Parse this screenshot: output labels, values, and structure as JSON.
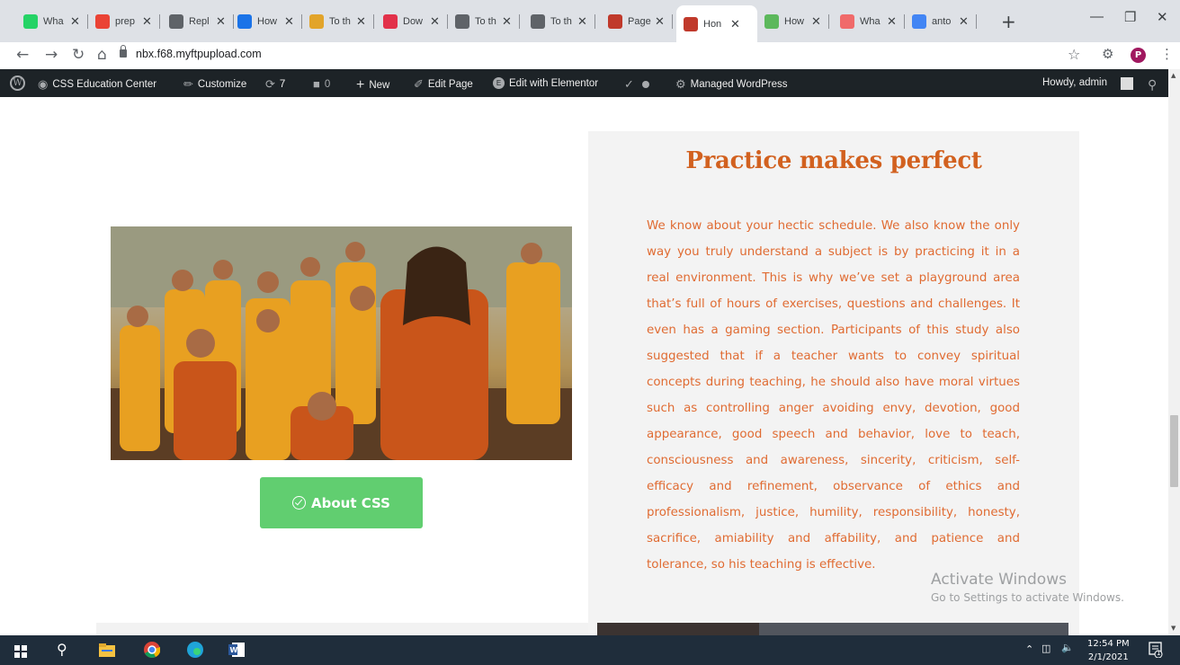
{
  "browser": {
    "tabs": [
      {
        "title": "Wha",
        "icon": "whatsapp-icon",
        "color": "#25d366"
      },
      {
        "title": "prep",
        "icon": "gmail-icon",
        "color": "#ea4335"
      },
      {
        "title": "Repl",
        "icon": "globe-icon",
        "color": "#5f6368"
      },
      {
        "title": "How",
        "icon": "quora-icon",
        "color": "#1a73e8"
      },
      {
        "title": "To th",
        "icon": "elementor-icon",
        "color": "#e2a42a"
      },
      {
        "title": "Dow",
        "icon": "heart-icon",
        "color": "#e2314a"
      },
      {
        "title": "To th",
        "icon": "globe-icon",
        "color": "#5f6368"
      },
      {
        "title": "To th",
        "icon": "globe-icon",
        "color": "#5f6368"
      },
      {
        "title": "Page",
        "icon": "site-icon",
        "color": "#c0392b"
      },
      {
        "title": "Hon",
        "icon": "site-icon",
        "color": "#c0392b",
        "active": true
      },
      {
        "title": "How",
        "icon": "grammarly-icon",
        "color": "#5cb85c"
      },
      {
        "title": "Wha",
        "icon": "asana-icon",
        "color": "#f06a6a"
      },
      {
        "title": "anto",
        "icon": "google-icon",
        "color": "#4285f4"
      }
    ],
    "url": "nbx.f68.myftpupload.com"
  },
  "wpbar": {
    "site_name": "CSS Education Center",
    "customize": "Customize",
    "updates_count": "7",
    "comments_count": "0",
    "new": "New",
    "edit_page": "Edit Page",
    "edit_elementor": "Edit with Elementor",
    "managed": "Managed WordPress",
    "howdy": "Howdy, admin"
  },
  "content": {
    "heading": "Practice makes perfect",
    "paragraph": "We know about your hectic schedule. We also know the only way you truly understand a subject is by practicing it in a real environment. This is why we’ve set a playground area that’s full of hours of exercises, questions and challenges. It even has a gaming section. Participants of this study also suggested that if a teacher wants to convey spiritual concepts during teaching, he should also have moral virtues such as controlling anger avoiding envy, devotion, good appearance, good speech and behavior, love to teach, consciousness and awareness, sincerity, criticism, self-efficacy and refinement, observance of ethics and professionalism, justice, humility, responsibility, honesty, sacrifice, amiability and affability, and patience and tolerance, so his teaching is effective.",
    "button_label": "About CSS",
    "accent_color": "#d2611f",
    "button_color": "#61ce70"
  },
  "watermark": {
    "line1": "Activate Windows",
    "line2": "Go to Settings to activate Windows."
  },
  "taskbar": {
    "time": "12:54 PM",
    "date": "2/1/2021",
    "notifications": "1"
  }
}
